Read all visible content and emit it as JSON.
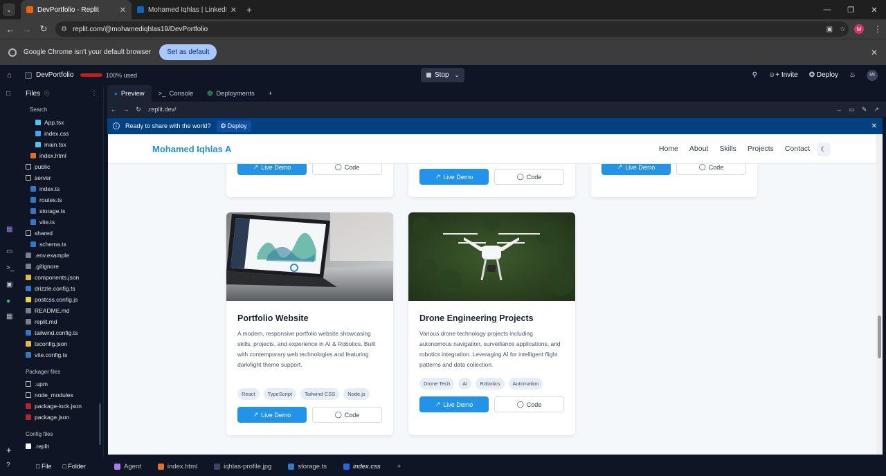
{
  "browser": {
    "tabs": [
      {
        "title": "DevPortfolio - Replit",
        "active": true
      },
      {
        "title": "Mohamed Iqhlas | LinkedIn",
        "active": false
      }
    ],
    "url": "replit.com/@mohamediqhlas19/DevPortfolio",
    "infobar": {
      "message": "Google Chrome isn't your default browser",
      "button": "Set as default"
    },
    "profile_initial": "M"
  },
  "replit": {
    "project_name": "DevPortfolio",
    "usage": "100% used",
    "stop_label": "Stop",
    "invite_label": "Invite",
    "deploy_label": "Deploy",
    "user_initials": "MI",
    "files_title": "Files",
    "search_label": "Search",
    "file_tree": [
      {
        "name": "App.tsx",
        "indent": 2,
        "kind": "react"
      },
      {
        "name": "index.css",
        "indent": 2,
        "kind": "css"
      },
      {
        "name": "main.tsx",
        "indent": 2,
        "kind": "react"
      },
      {
        "name": "index.html",
        "indent": 1,
        "kind": "html"
      },
      {
        "name": "public",
        "indent": 0,
        "kind": "folder"
      },
      {
        "name": "server",
        "indent": 0,
        "kind": "folder-open"
      },
      {
        "name": "index.ts",
        "indent": 1,
        "kind": "ts"
      },
      {
        "name": "routes.ts",
        "indent": 1,
        "kind": "ts"
      },
      {
        "name": "storage.ts",
        "indent": 1,
        "kind": "ts"
      },
      {
        "name": "vite.ts",
        "indent": 1,
        "kind": "ts"
      },
      {
        "name": "shared",
        "indent": 0,
        "kind": "folder-open"
      },
      {
        "name": "schema.ts",
        "indent": 1,
        "kind": "ts"
      },
      {
        "name": ".env.example",
        "indent": 0,
        "kind": "file"
      },
      {
        "name": ".gitignore",
        "indent": 0,
        "kind": "file"
      },
      {
        "name": "components.json",
        "indent": 0,
        "kind": "json"
      },
      {
        "name": "drizzle.config.ts",
        "indent": 0,
        "kind": "ts"
      },
      {
        "name": "postcss.config.js",
        "indent": 0,
        "kind": "js"
      },
      {
        "name": "README.md",
        "indent": 0,
        "kind": "md"
      },
      {
        "name": "replit.md",
        "indent": 0,
        "kind": "md"
      },
      {
        "name": "tailwind.config.ts",
        "indent": 0,
        "kind": "ts"
      },
      {
        "name": "tsconfig.json",
        "indent": 0,
        "kind": "json"
      },
      {
        "name": "vite.config.ts",
        "indent": 0,
        "kind": "ts"
      }
    ],
    "packager_label": "Packager files",
    "packager_files": [
      {
        "name": ".upm",
        "kind": "folder"
      },
      {
        "name": "node_modules",
        "kind": "folder"
      },
      {
        "name": "package-lock.json",
        "kind": "npm"
      },
      {
        "name": "package.json",
        "kind": "npm"
      }
    ],
    "config_label": "Config files",
    "config_files": [
      {
        "name": ".replit",
        "kind": "replit"
      }
    ],
    "file_btn": "File",
    "folder_btn": "Folder",
    "pane_tabs": [
      "Preview",
      "Console",
      "Deployments"
    ],
    "preview_url": ".replit.dev/",
    "deploy_banner": {
      "message": "Ready to share with the world?",
      "button": "Deploy"
    },
    "bottom_tabs": [
      "Agent",
      "index.html",
      "iqhlas-profile.jpg",
      "storage.ts",
      "index.css"
    ]
  },
  "site": {
    "brand": "Mohamed Iqhlas A",
    "nav": [
      "Home",
      "About",
      "Skills",
      "Projects",
      "Contact"
    ],
    "live_demo": "Live Demo",
    "code": "Code",
    "projects": [
      {
        "title": "Portfolio Website",
        "description": "A modern, responsive portfolio website showcasing skills, projects, and experience in AI & Robotics. Built with contemporary web technologies and featuring dark/light theme support.",
        "tags": [
          "React",
          "TypeScript",
          "Tailwind CSS",
          "Node.js"
        ]
      },
      {
        "title": "Drone Engineering Projects",
        "description": "Various drone technology projects including autonomous navigation, surveillance applications, and robotics integration. Leveraging AI for intelligent flight patterns and data collection.",
        "tags": [
          "Drone Tech",
          "AI",
          "Robotics",
          "Automation"
        ]
      }
    ]
  }
}
